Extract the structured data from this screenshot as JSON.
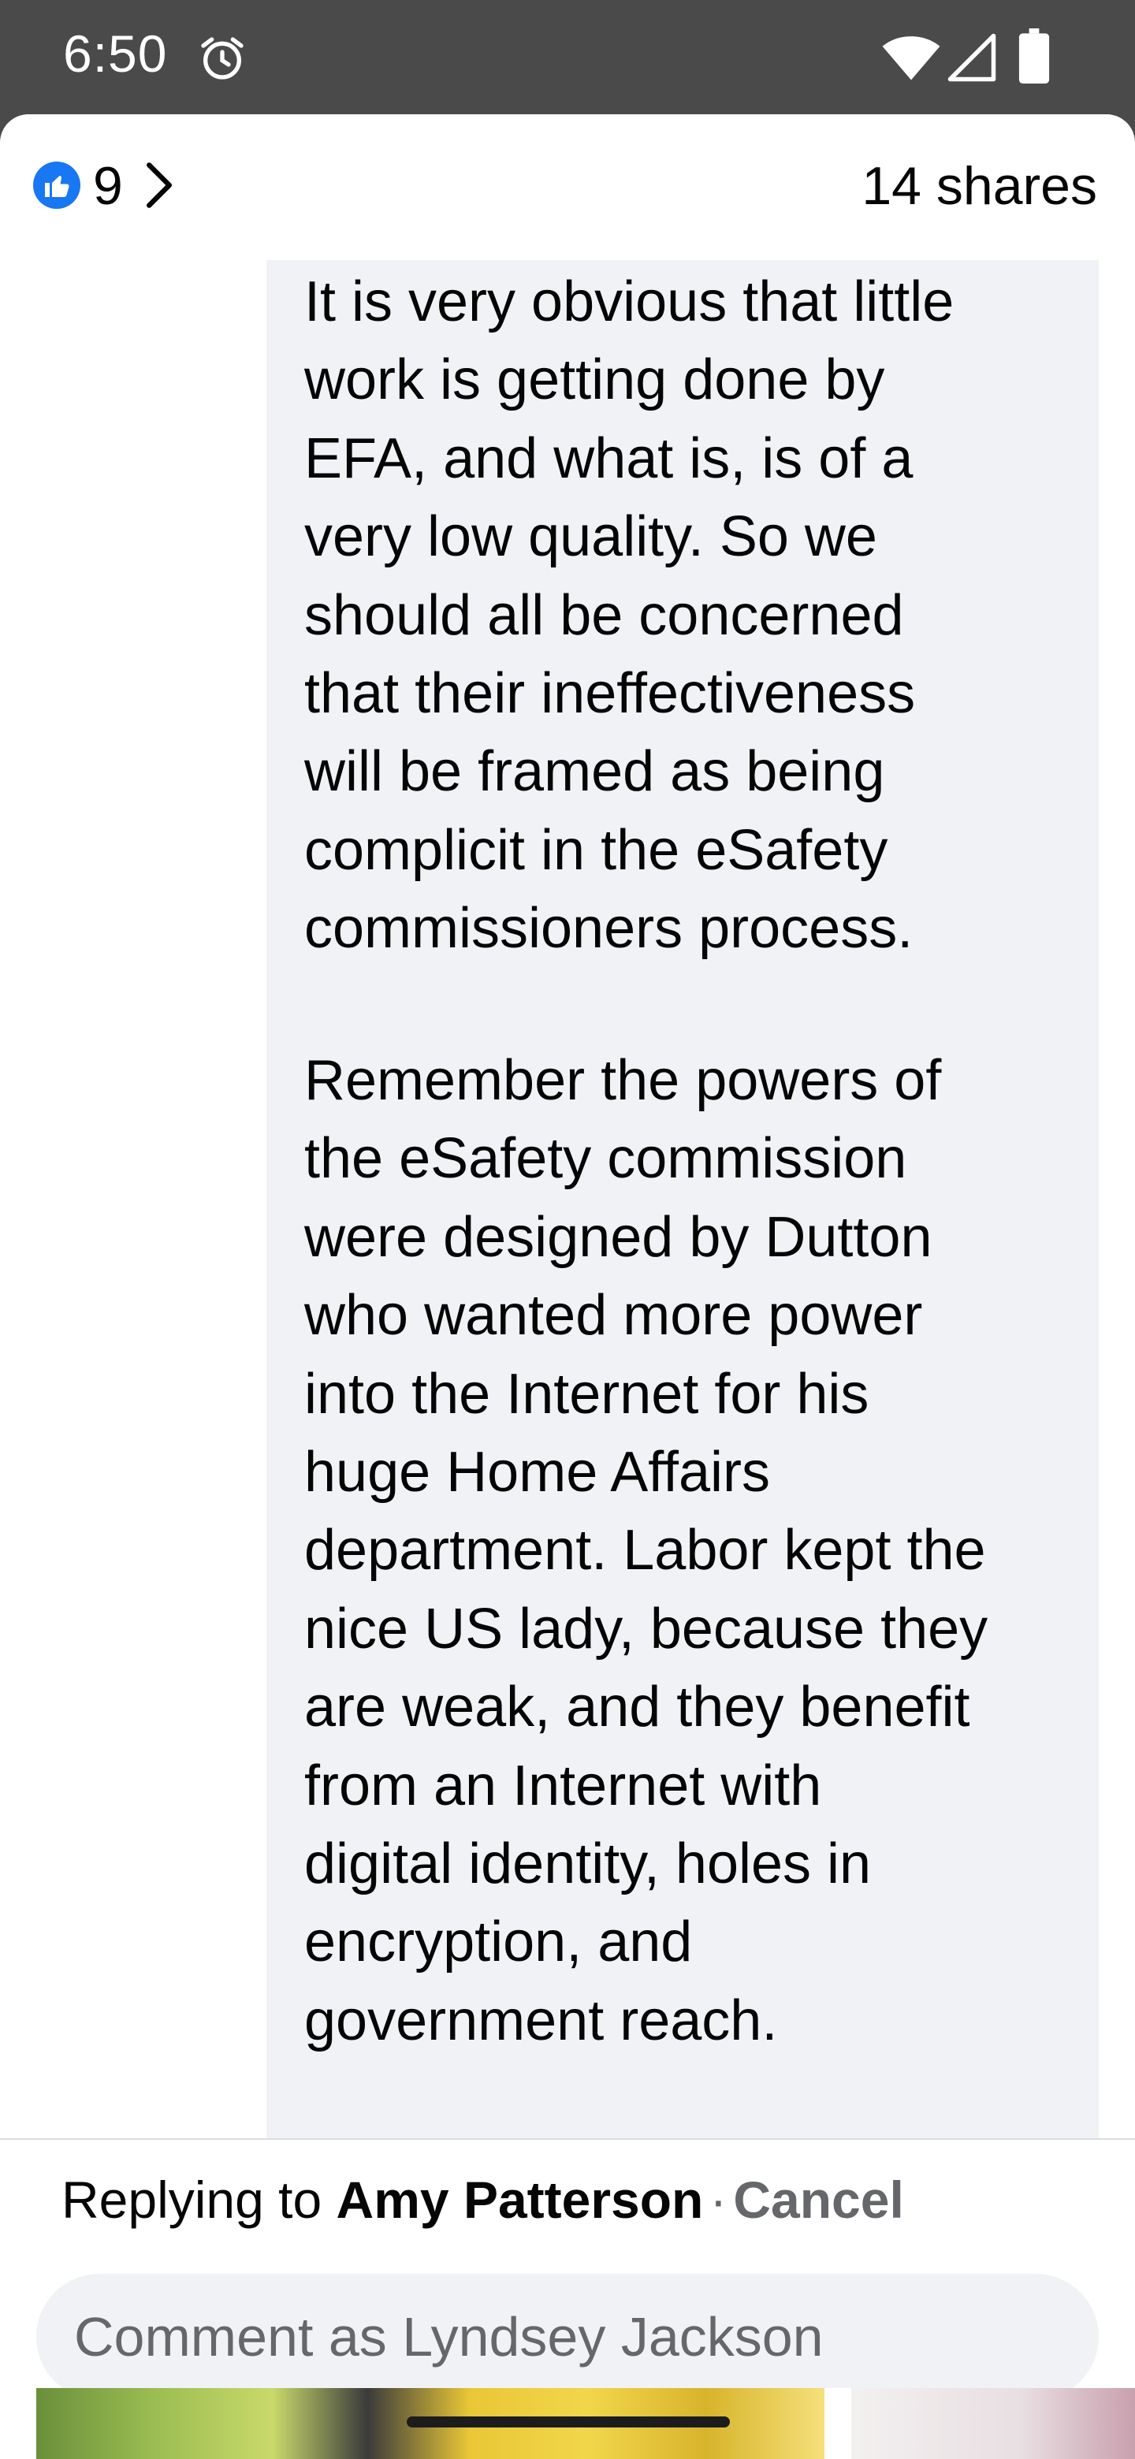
{
  "status_bar": {
    "time": "6:50",
    "icons": [
      "alarm-icon",
      "wifi-icon",
      "signal-icon",
      "battery-icon"
    ]
  },
  "reactions": {
    "like_count": "9",
    "shares": "14 shares",
    "like_color": "#1877f2"
  },
  "comment": {
    "paragraph1": "It is very obvious that little\nwork is getting done by\nEFA, and what is, is of a\nvery low quality. So we\nshould all be concerned\nthat their ineffectiveness\nwill be framed as being\ncomplicit in the eSafety\ncommissioners process.",
    "paragraph2": "Remember the powers of\nthe eSafety commission\nwere designed by Dutton\nwho wanted more power\ninto the Internet for his\nhuge Home Affairs\ndepartment. Labor kept the\nnice US lady, because they\nare weak, and they benefit\nfrom an Internet with\ndigital identity, holes in\nencryption, and\ngovernment reach."
  },
  "reply": {
    "prefix": "Replying to",
    "name": "Amy Patterson",
    "separator": "·",
    "cancel": "Cancel",
    "placeholder": "Comment as Lyndsey Jackson"
  }
}
